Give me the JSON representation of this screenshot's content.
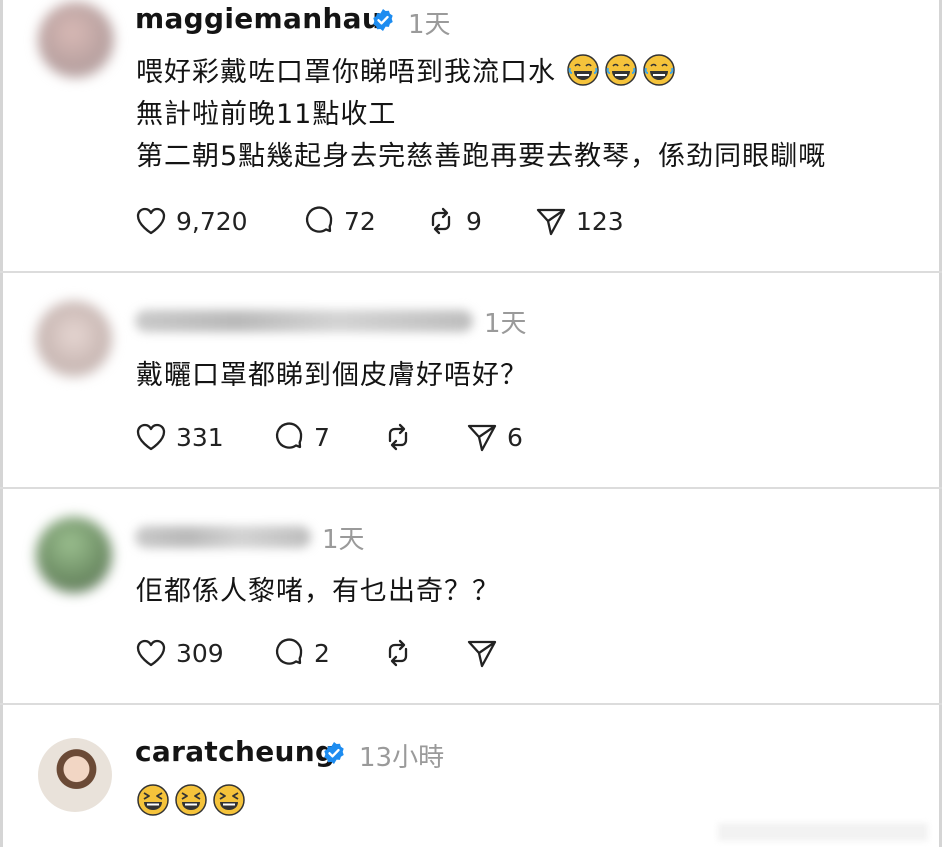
{
  "posts": [
    {
      "username": "maggiemanhau",
      "verified": true,
      "time": "1天",
      "lines": [
        "喂好彩戴咗口罩你睇唔到我流口水",
        "無計啦前晚11點收工",
        "第二朝5點幾起身去完慈善跑再要去教琴，係劲同眼瞓嘅"
      ],
      "emojis": [
        "laughing-tears-emoji",
        "laughing-tears-emoji",
        "laughing-tears-emoji"
      ],
      "likes": "9,720",
      "comments": "72",
      "reposts": "9",
      "shares": "123"
    },
    {
      "username_blurred": true,
      "time": "1天",
      "lines": [
        "戴曬口罩都睇到個皮膚好唔好？"
      ],
      "likes": "331",
      "comments": "7",
      "reposts": "",
      "shares": "6"
    },
    {
      "username_blurred": true,
      "time": "1天",
      "lines": [
        "佢都係人黎啫，有乜出奇？？"
      ],
      "likes": "309",
      "comments": "2",
      "reposts": "",
      "shares": ""
    },
    {
      "username": "caratcheung",
      "verified": true,
      "time": "13小時",
      "emojis": [
        "grinning-squint-emoji",
        "grinning-squint-emoji",
        "grinning-squint-emoji"
      ]
    }
  ],
  "colors": {
    "verified": "#1d8cf0",
    "emoji_face": "#f5c33b",
    "divider": "#dcdcdc",
    "muted_text": "#9a9a9a"
  }
}
